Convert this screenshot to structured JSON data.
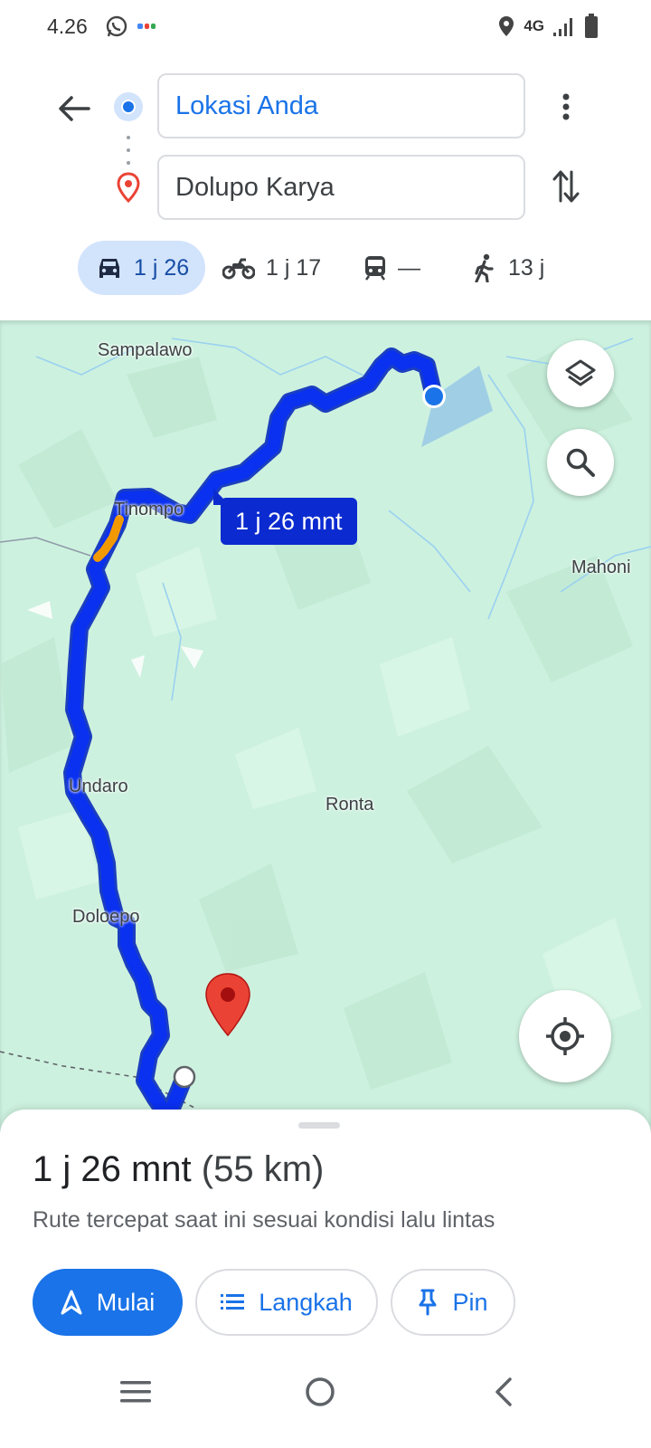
{
  "status_bar": {
    "time": "4.26",
    "network": "4G"
  },
  "search": {
    "origin_value": "Lokasi Anda",
    "destination_value": "Dolupo Karya"
  },
  "modes": [
    {
      "name": "driving",
      "label": "1 j 26",
      "active": true
    },
    {
      "name": "motorcycle",
      "label": "1 j 17",
      "active": false
    },
    {
      "name": "transit",
      "label": "—",
      "active": false
    },
    {
      "name": "walking",
      "label": "13 j",
      "active": false
    }
  ],
  "map": {
    "labels": {
      "sampalawo": "Sampalawo",
      "tinompo": "Tinompo",
      "mahoni": "Mahoni",
      "undaro": "Undaro",
      "ronta": "Ronta",
      "doloepo": "Doloepo"
    },
    "eta_bubble": "1 j 26 mnt",
    "route_color": "#0b2bd0",
    "traffic_color": "#f29900",
    "destination_pin_color": "#ea4335"
  },
  "sheet": {
    "duration": "1 j 26 mnt",
    "distance": "(55 km)",
    "description": "Rute tercepat saat ini sesuai kondisi lalu lintas",
    "start_label": "Mulai",
    "steps_label": "Langkah",
    "pin_label": "Pin"
  },
  "colors": {
    "accent": "#1a73e8",
    "map_bg": "#cdf1df"
  }
}
